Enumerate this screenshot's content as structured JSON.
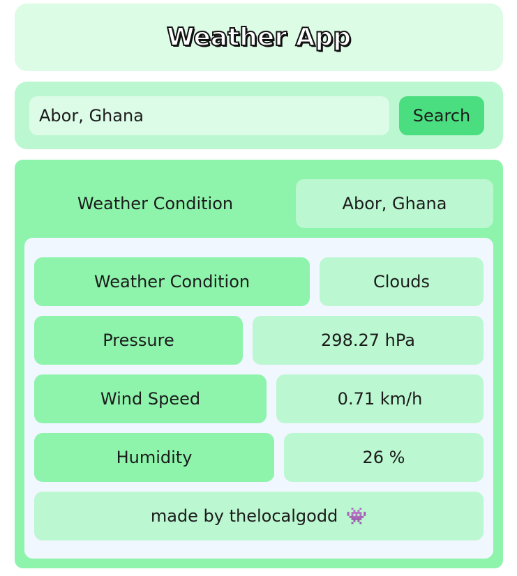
{
  "header": {
    "title": "Weather App"
  },
  "search": {
    "value": "Abor, Ghana",
    "button_label": "Search"
  },
  "weather": {
    "title": "Weather Condition",
    "location": "Abor, Ghana",
    "rows": [
      {
        "label": "Weather Condition",
        "value": "Clouds"
      },
      {
        "label": "Pressure",
        "value": "298.27 hPa"
      },
      {
        "label": "Wind Speed",
        "value": "0.71 km/h"
      },
      {
        "label": "Humidity",
        "value": "26 %"
      }
    ],
    "footer_text": "made by thelocalgodd",
    "footer_icon": "👾"
  }
}
